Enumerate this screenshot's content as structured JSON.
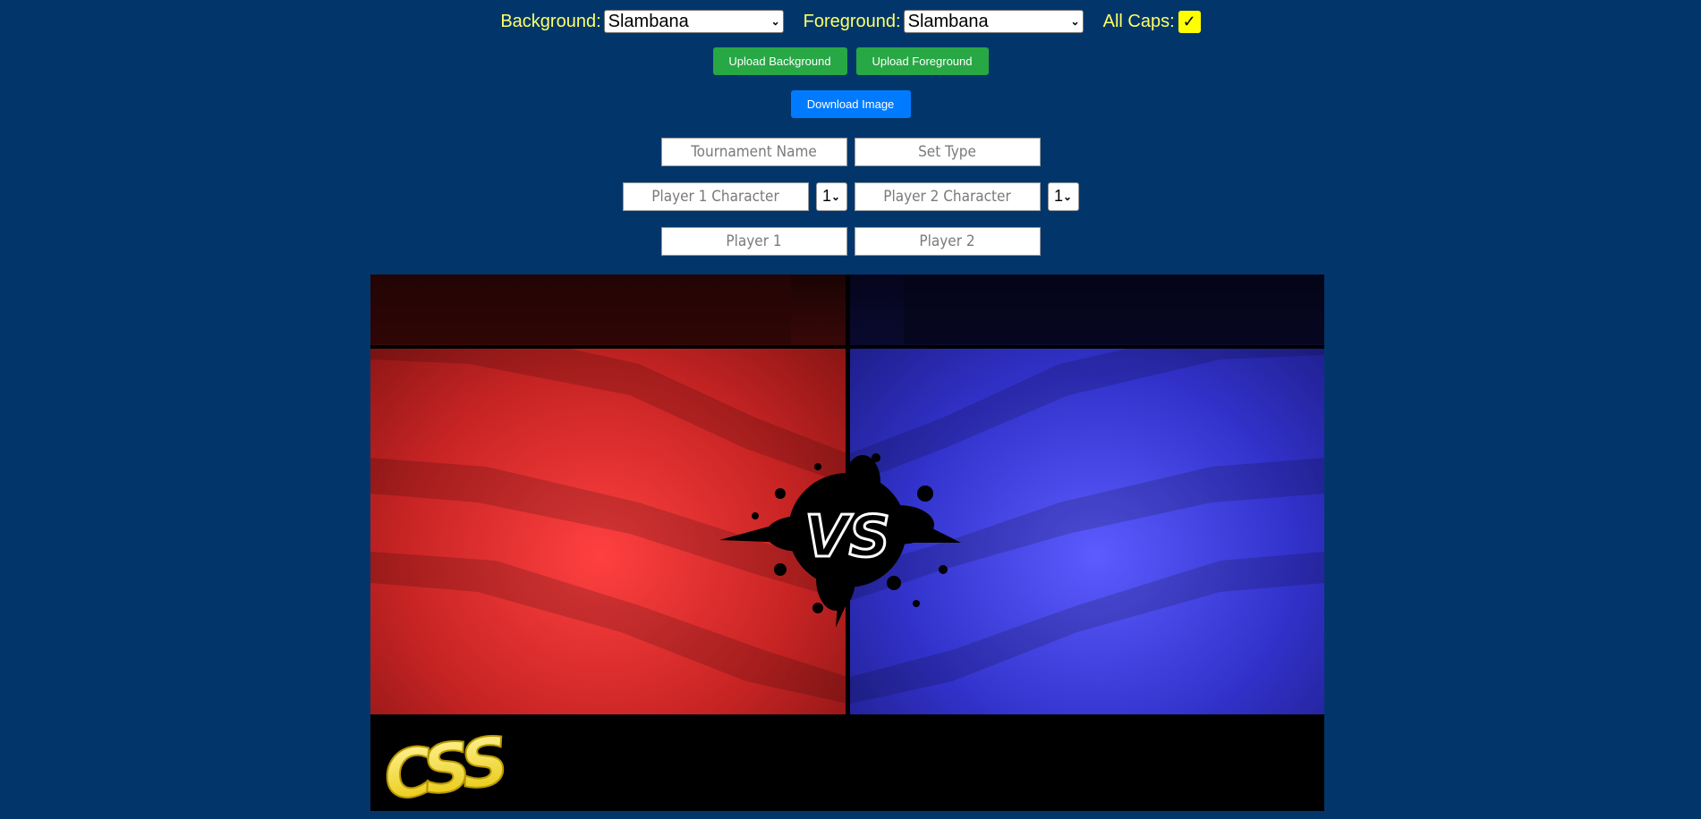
{
  "controls": {
    "background_label": "Background:",
    "background_value": "Slambana",
    "foreground_label": "Foreground:",
    "foreground_value": "Slambana",
    "allcaps_label": "All Caps:",
    "allcaps_checked": true,
    "upload_background": "Upload Background",
    "upload_foreground": "Upload Foreground",
    "download_image": "Download Image"
  },
  "fields": {
    "tournament_name": "Tournament Name",
    "set_type": "Set Type",
    "player1_character": "Player 1 Character",
    "player1_skin": "1",
    "player2_character": "Player 2 Character",
    "player2_skin": "1",
    "player1": "Player 1",
    "player2": "Player 2"
  },
  "preview": {
    "vs_text": "VS",
    "logo_text": "CSS",
    "colors": {
      "left": "#e8302e",
      "right": "#4141e6",
      "footer": "#000000",
      "logo": "#ffe733"
    }
  }
}
